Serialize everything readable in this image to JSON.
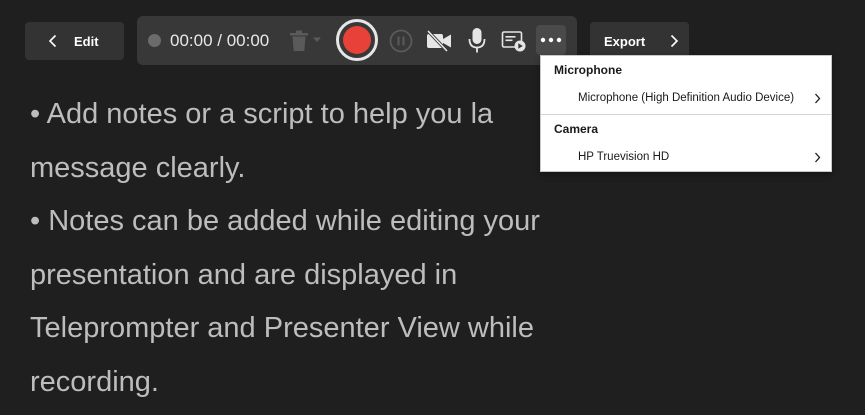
{
  "header": {
    "edit_label": "Edit",
    "export_label": "Export"
  },
  "toolbar": {
    "timer": "00:00 / 00:00",
    "icons": [
      "record-indicator-icon",
      "trash-icon",
      "chevron-down-icon",
      "record-icon",
      "pause-icon",
      "camera-off-icon",
      "microphone-icon",
      "teleprompter-icon",
      "more-icon"
    ],
    "record_color": "#e8413a"
  },
  "notes": {
    "paragraphs": [
      "• Add notes or a script to help you lay out your message clearly.",
      "• Notes can be added while editing your presentation and are displayed in Teleprompter and Presenter View while recording."
    ],
    "visible_lines": [
      "• Add notes or a script to help you la",
      "message clearly.",
      "• Notes can be added while editing your",
      "presentation and are displayed in",
      "Teleprompter and Presenter View while",
      "recording."
    ]
  },
  "menu": {
    "sections": [
      {
        "header": "Microphone",
        "item": "Microphone (High Definition Audio Device)"
      },
      {
        "header": "Camera",
        "item": "HP Truevision HD"
      }
    ]
  }
}
